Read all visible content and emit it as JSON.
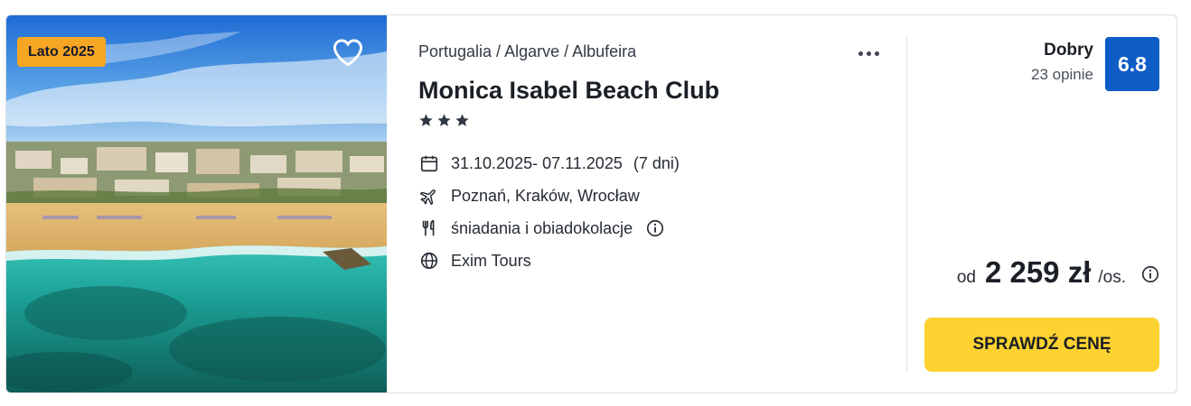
{
  "card": {
    "season_badge": "Lato 2025",
    "breadcrumb": "Portugalia / Algarve / Albufeira",
    "hotel_name": "Monica Isabel Beach Club",
    "stars": 3,
    "dates": "31.10.2025- 07.11.2025",
    "duration": "(7 dni)",
    "departure": "Poznań, Kraków, Wrocław",
    "board": "śniadania i obiadokolacje",
    "operator": "Exim Tours",
    "rating": {
      "label": "Dobry",
      "count": "23 opinie",
      "score": "6.8"
    },
    "price": {
      "prefix": "od",
      "value": "2 259 zł",
      "unit": "/os."
    },
    "cta_label": "SPRAWDŹ CENĘ"
  },
  "colors": {
    "badge": "#f6a623",
    "score": "#0e5cc6",
    "cta": "#fdd231"
  },
  "icons": [
    "heart-icon",
    "more-icon",
    "star-icon",
    "calendar-icon",
    "plane-icon",
    "utensils-icon",
    "info-icon",
    "globe-icon"
  ]
}
